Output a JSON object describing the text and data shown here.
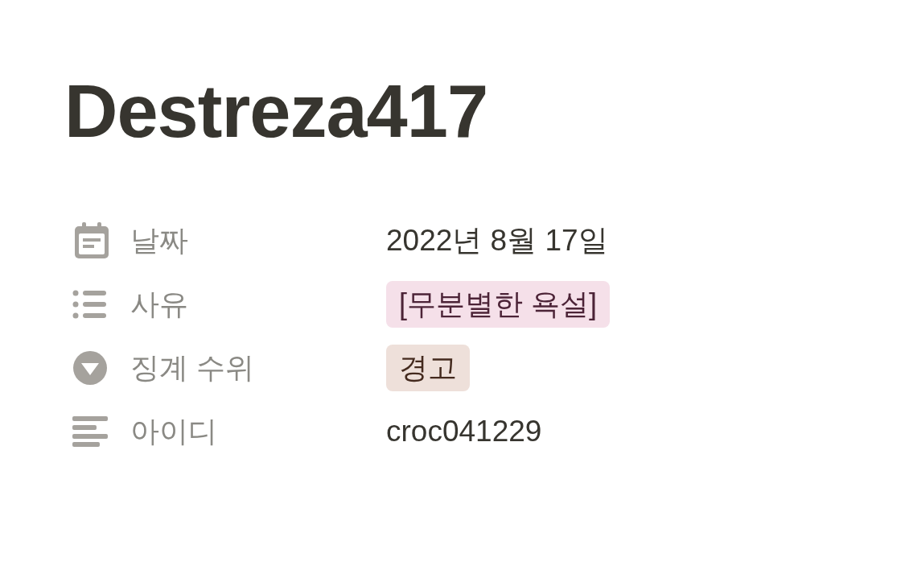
{
  "title": "Destreza417",
  "properties": [
    {
      "kind": "date",
      "label": "날짜",
      "value": "2022년 8월 17일"
    },
    {
      "kind": "multi_select",
      "label": "사유",
      "tags": [
        {
          "text": "[무분별한 욕설]",
          "color": "#f5e0e9"
        }
      ]
    },
    {
      "kind": "select",
      "label": "징계 수위",
      "tags": [
        {
          "text": "경고",
          "color": "#eee0da"
        }
      ]
    },
    {
      "kind": "text",
      "label": "아이디",
      "value": "croc041229"
    }
  ]
}
